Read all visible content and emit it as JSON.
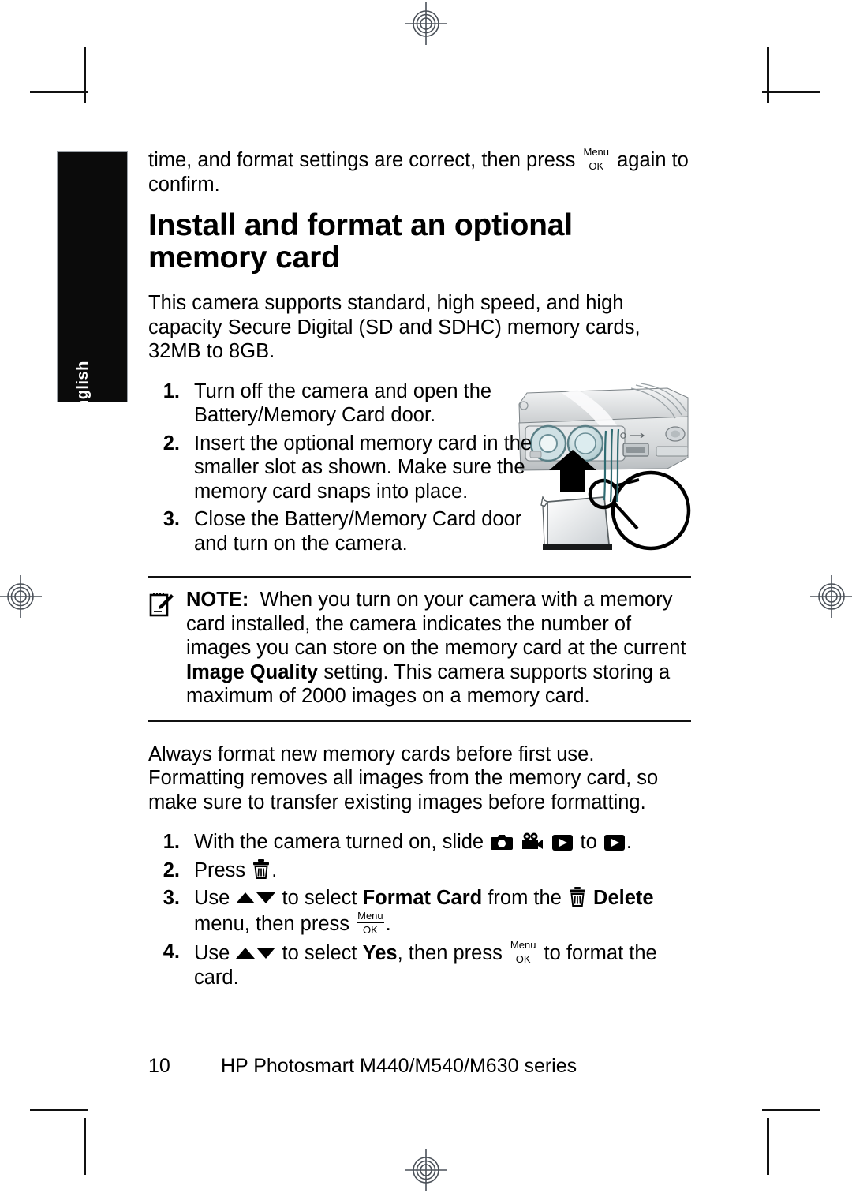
{
  "document": {
    "language_tab": "English",
    "page_number": "10",
    "footer_title": "HP Photosmart M440/M540/M630 series"
  },
  "content": {
    "carryover_paragraph": {
      "before": "time, and format settings are correct, then press",
      "after": "again to confirm."
    },
    "heading": "Install and format an optional memory card",
    "intro_paragraph": "This camera supports standard, high speed, and high capacity Secure Digital (SD and SDHC) memory cards, 32MB to 8GB.",
    "install_steps": [
      {
        "num": "1.",
        "text": "Turn off the camera and open the Battery/Memory Card door."
      },
      {
        "num": "2.",
        "text": "Insert the optional memory card in the smaller slot as shown. Make sure the memory card snaps into place."
      },
      {
        "num": "3.",
        "text": "Close the Battery/Memory Card door and turn on the camera."
      }
    ],
    "note": {
      "label": "NOTE:",
      "part1": "When you turn on your camera with a memory card installed, the camera indicates the number of images you can store on the memory card at the current",
      "emphasis": "Image Quality",
      "part2": "setting. This camera supports storing a maximum of 2000 images on a memory card."
    },
    "format_paragraph": "Always format new memory cards before first use. Formatting removes all images from the memory card, so make sure to transfer existing images before formatting.",
    "format_steps": {
      "step1": {
        "num": "1.",
        "before": "With the camera turned on, slide",
        "middle": "to",
        "after": "."
      },
      "step2": {
        "num": "2.",
        "before": "Press",
        "after": "."
      },
      "step3": {
        "num": "3.",
        "before": "Use",
        "mid1": "to select",
        "bold1": "Format Card",
        "mid2": "from the",
        "bold2": "Delete",
        "mid3": "menu, then press",
        "after": "."
      },
      "step4": {
        "num": "4.",
        "before": "Use",
        "mid1": "to select",
        "bold1": "Yes",
        "mid2": ", then press",
        "after": "to format the card."
      }
    },
    "menu_ok_glyph": {
      "top": "Menu",
      "bottom": "OK"
    }
  },
  "illustration": {
    "name": "camera-memory-card-slot-photo",
    "caption_elements": [
      "camera-bottom-body",
      "battery-slot",
      "memory-card-slot",
      "usb-port",
      "insertion-arrow",
      "magnifier-callout",
      "sd-memory-card"
    ]
  },
  "printer_marks": {
    "registration": [
      "top-center",
      "left-middle",
      "right-middle",
      "bottom-center"
    ],
    "crop_corners": [
      "top-left",
      "top-right",
      "bottom-left",
      "bottom-right"
    ]
  },
  "colors": {
    "ink": "#000000",
    "paper": "#ffffff",
    "tab_background": "#0b0b0b",
    "tab_text": "#ffffff",
    "registration_mark": "#4a5058"
  }
}
